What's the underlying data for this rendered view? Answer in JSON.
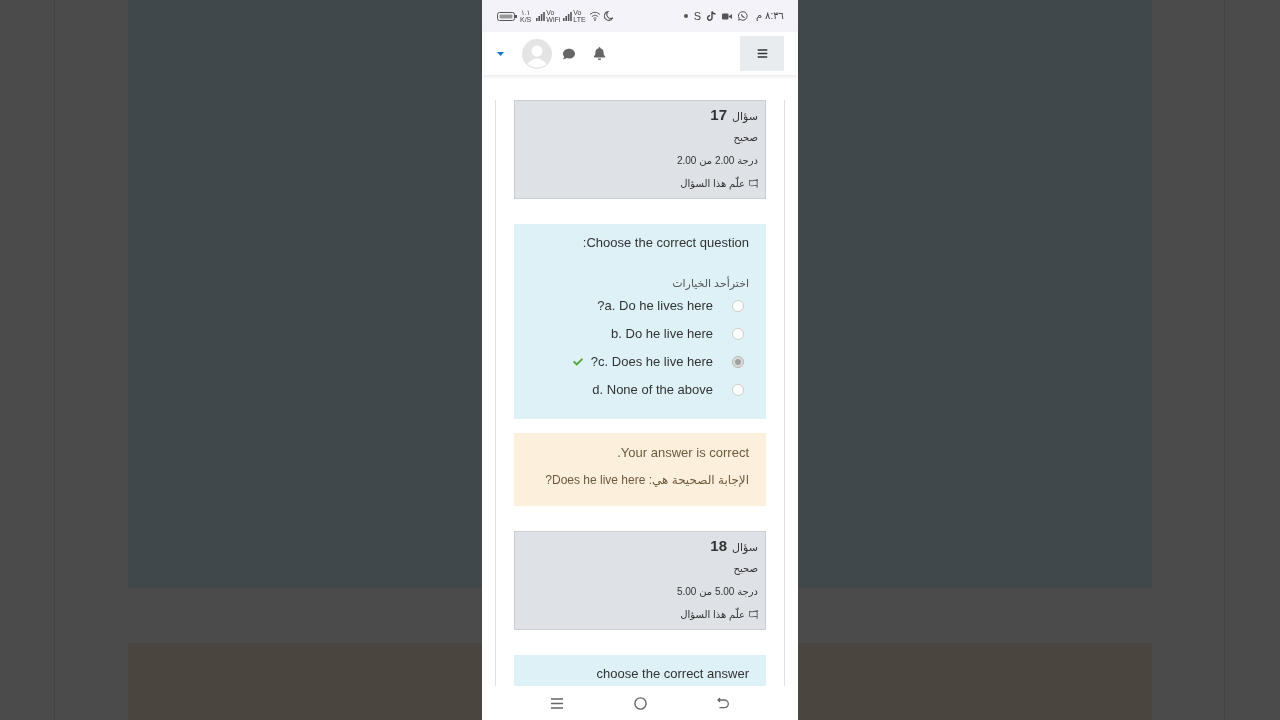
{
  "status_bar": {
    "time": "٨:٣٦ م",
    "notification_letter": "S",
    "network_labels": [
      "Vo LTE",
      "Vo WiFi"
    ],
    "speed": "١.١ K/S"
  },
  "questions": [
    {
      "info": {
        "label": "سؤال",
        "number": "17",
        "status": "صحيح",
        "grade": "درجة 2.00 من 2.00",
        "flag": "علّم هذا السؤال"
      },
      "prompt": "Choose the correct question:",
      "instruction": "اخترأحد الخيارات",
      "options": [
        {
          "text": "a. Do he lives here?",
          "selected": false,
          "correct": false
        },
        {
          "text": "b. Do he live here",
          "selected": false,
          "correct": false
        },
        {
          "text": "c. Does he live here?",
          "selected": true,
          "correct": true
        },
        {
          "text": "d. None of the above",
          "selected": false,
          "correct": false
        }
      ],
      "feedback": {
        "result": "Your answer is correct.",
        "right_answer": "الإجابة الصحيحة هي: Does he live here?"
      }
    },
    {
      "info": {
        "label": "سؤال",
        "number": "18",
        "status": "صحيح",
        "grade": "درجة 5.00 من 5.00",
        "flag": "علّم هذا السؤال"
      },
      "prompt": "choose the correct answer"
    }
  ]
}
